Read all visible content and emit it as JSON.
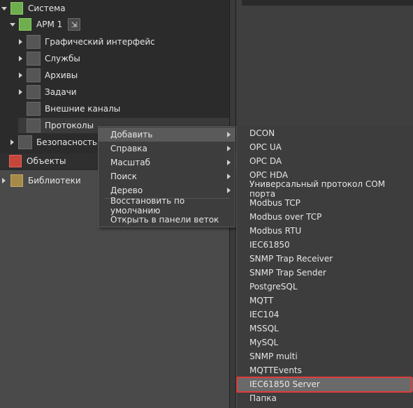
{
  "tree": {
    "system": "Система",
    "arm": "АРМ 1",
    "items": [
      {
        "label": "Графический интерфейс",
        "expand": "right"
      },
      {
        "label": "Службы",
        "expand": "right"
      },
      {
        "label": "Архивы",
        "expand": "right"
      },
      {
        "label": "Задачи",
        "expand": "right"
      },
      {
        "label": "Внешние каналы",
        "expand": "none"
      },
      {
        "label": "Протоколы",
        "expand": "none"
      }
    ],
    "security": "Безопасность",
    "objects": "Объекты",
    "libraries": "Библиотеки"
  },
  "context_menu": {
    "items": [
      {
        "label": "Добавить",
        "submenu": true
      },
      {
        "label": "Справка",
        "submenu": true
      },
      {
        "label": "Масштаб",
        "submenu": true
      },
      {
        "label": "Поиск",
        "submenu": true
      },
      {
        "label": "Дерево",
        "submenu": true
      },
      {
        "label": "Восстановить по умолчанию",
        "submenu": false
      },
      {
        "label": "Открыть в панели веток",
        "submenu": false
      }
    ]
  },
  "submenu": {
    "items": [
      "DCON",
      "OPC UA",
      "OPC DA",
      "OPC HDA",
      "Универсальный протокол COM порта",
      "Modbus TCP",
      "Modbus over TCP",
      "Modbus RTU",
      "IEC61850",
      "SNMP Trap Receiver",
      "SNMP Trap Sender",
      "PostgreSQL",
      "MQTT",
      "IEC104",
      "MSSQL",
      "MySQL",
      "SNMP multi",
      "MQTTEvents",
      "IEC61850 Server",
      "Папка"
    ],
    "highlighted_index": 18
  },
  "colors": {
    "highlight_border": "#e23b3b",
    "system_icon": "#6fae4e",
    "objects_icon": "#c7463b",
    "libs_icon": "#a58a4a"
  }
}
